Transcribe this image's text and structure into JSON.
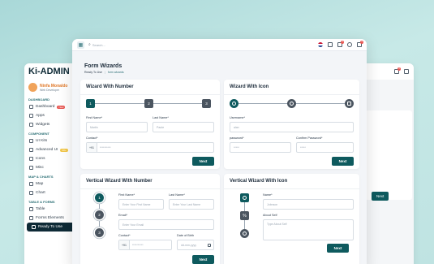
{
  "sidebar": {
    "brand": "Ki-ADMIN",
    "user_name": "Ninfa Monaldo",
    "user_role": "Web Developer",
    "sections": [
      {
        "title": "DASHBOARD",
        "items": [
          {
            "label": "Dashboard",
            "badge": "New"
          },
          {
            "label": "Apps"
          },
          {
            "label": "Widgets"
          }
        ]
      },
      {
        "title": "COMPONENT",
        "items": [
          {
            "label": "UI Kits"
          },
          {
            "label": "Advanced UI",
            "badge": "10+"
          },
          {
            "label": "Icons"
          },
          {
            "label": "Misc"
          }
        ]
      },
      {
        "title": "MAP & CHARTS",
        "items": [
          {
            "label": "Map"
          },
          {
            "label": "Chart"
          }
        ]
      },
      {
        "title": "TABLE & FORMS",
        "items": [
          {
            "label": "Table"
          },
          {
            "label": "Forms Elements"
          },
          {
            "label": "Ready To Use"
          }
        ]
      }
    ]
  },
  "topbar": {
    "search_placeholder": "Search...",
    "cart_count": "3",
    "bell_count": "4"
  },
  "page": {
    "title": "Form Wizards",
    "breadcrumb": [
      "Ready To Use",
      "form wizards"
    ]
  },
  "card1": {
    "title": "Wizard With Number",
    "steps": [
      "1",
      "2",
      "3"
    ],
    "first_name_label": "First Name*",
    "first_name_ph": "Martin",
    "last_name_label": "Last Name*",
    "last_name_ph": "Paute",
    "contact_label": "Contact*",
    "contact_prefix": "+91",
    "contact_ph": "**********",
    "next": "Next"
  },
  "card2": {
    "title": "Wizard With Icon",
    "username_label": "Username*",
    "username_ph": "alan",
    "password_label": "password*",
    "password_ph": "*****",
    "confirm_label": "Confirm Password*",
    "confirm_ph": "*****",
    "next": "Next"
  },
  "card3": {
    "title": "Vertical Wizard With Number",
    "steps": [
      "1",
      "2",
      "3"
    ],
    "first_name_label": "First Name*",
    "first_name_ph": "Enter Your First Name",
    "last_name_label": "Last Name*",
    "last_name_ph": "Enter Your Last Name",
    "email_label": "Email*",
    "email_ph": "Enter Your Email",
    "contact_label": "Contact*",
    "contact_prefix": "+91",
    "contact_ph": "**********",
    "dob_label": "Date of Birth",
    "dob_ph": "dd-mm-yyyy",
    "next": "Next"
  },
  "card4": {
    "title": "Vertical Wizard With Icon",
    "name_label": "Name*",
    "name_ph": "Jobnson",
    "about_label": "About Self",
    "about_ph": "Type About Self",
    "next": "Next"
  },
  "back_right": {
    "cart_count": "4",
    "next": "Next"
  }
}
